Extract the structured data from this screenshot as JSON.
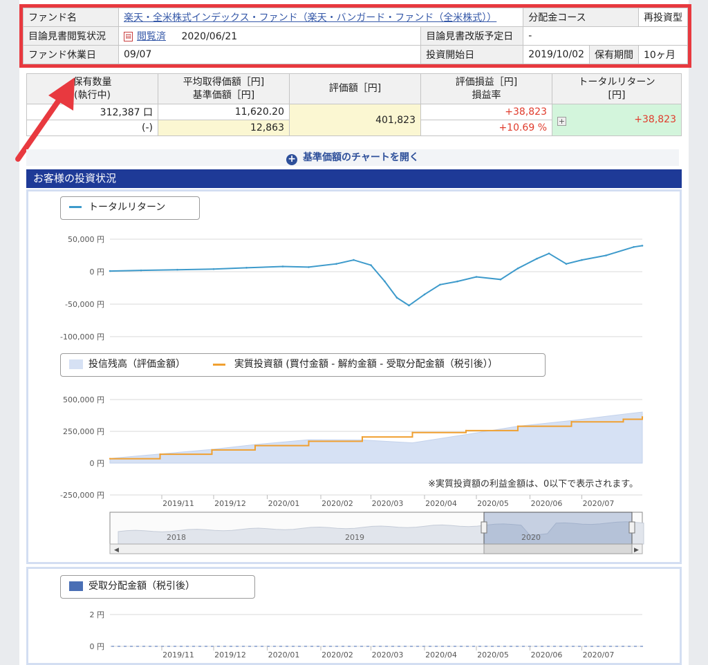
{
  "fund_info": {
    "fund_name_label": "ファンド名",
    "fund_name": "楽天・全米株式インデックス・ファンド（楽天・バンガード・ファンド（全米株式））",
    "dist_course_label": "分配金コース",
    "dist_course": "再投資型",
    "prospectus_status_label": "目論見書閲覧状況",
    "prospectus_link": "閲覧済",
    "prospectus_date": "2020/06/21",
    "prospectus_revision_label": "目論見書改版予定日",
    "prospectus_revision": "-",
    "holiday_label": "ファンド休業日",
    "holiday": "09/07",
    "start_label": "投資開始日",
    "start_date": "2019/10/02",
    "period_label": "保有期間",
    "period": "10ヶ月"
  },
  "holdings": {
    "col_qty": "保有数量",
    "col_qty_sub": "(執行中)",
    "col_avg": "平均取得価額［円]",
    "col_avg_sub": "基準価額［円]",
    "col_value": "評価額［円]",
    "col_pl": "評価損益［円]",
    "col_pl_sub": "損益率",
    "col_total": "トータルリターン",
    "col_total_sub": "[円]",
    "qty": "312,387 口",
    "qty_pending": "(-)",
    "avg_price": "11,620.20",
    "nav": "12,863",
    "value": "401,823",
    "pl": "+38,823",
    "pl_rate": "+10.69 %",
    "total_return": "+38,823"
  },
  "chart_toggle_label": "基準価額のチャートを開く",
  "section_title": "お客様の投資状況",
  "legend_total_return": "トータルリターン",
  "legend_balance": "投信残高（評価金額）",
  "legend_invested": "実質投資額 (買付金額 - 解約金額 - 受取分配金額（税引後））",
  "legend_dist": "受取分配金額（税引後）",
  "note": "※実質投資額の利益金額は、0以下で表示されます。",
  "colors": {
    "accent_red": "#e8393f",
    "header_blue": "#1e3a97",
    "line_blue": "#3d9acb",
    "orange": "#f0a030",
    "area_fill": "#d6e1f4",
    "dist_blue": "#4a6fb5"
  },
  "chart_data": [
    {
      "type": "line",
      "title": "トータルリターン",
      "ylim": [
        -100000,
        50000
      ],
      "y_ticks": [
        "50,000 円",
        "0 円",
        "-50,000 円",
        "-100,000 円"
      ],
      "x_ticks": [
        "2019/11",
        "2019/12",
        "2020/01",
        "2020/02",
        "2020/03",
        "2020/04",
        "2020/05",
        "2020/06",
        "2020/07"
      ],
      "x": [
        "2019/10/02",
        "2019/10/20",
        "2019/11/10",
        "2019/12/01",
        "2019/12/20",
        "2020/01/10",
        "2020/01/25",
        "2020/02/10",
        "2020/02/20",
        "2020/03/01",
        "2020/03/09",
        "2020/03/16",
        "2020/03/23",
        "2020/04/01",
        "2020/04/10",
        "2020/04/20",
        "2020/05/01",
        "2020/05/15",
        "2020/05/25",
        "2020/06/05",
        "2020/06/12",
        "2020/06/22",
        "2020/07/01",
        "2020/07/15",
        "2020/07/31",
        "2020/08/05"
      ],
      "series": [
        {
          "name": "トータルリターン",
          "values": [
            1000,
            2000,
            3000,
            4000,
            6000,
            8000,
            7000,
            12000,
            18000,
            10000,
            -15000,
            -40000,
            -52000,
            -35000,
            -20000,
            -15000,
            -8000,
            -12000,
            5000,
            20000,
            28000,
            12000,
            18000,
            25000,
            38000,
            40000
          ]
        }
      ]
    },
    {
      "type": "area",
      "title": "",
      "ylim": [
        -250000,
        500000
      ],
      "y_ticks": [
        "500,000 円",
        "250,000 円",
        "0 円",
        "-250,000 円"
      ],
      "x_ticks": [
        "2019/11",
        "2019/12",
        "2020/01",
        "2020/02",
        "2020/03",
        "2020/04",
        "2020/05",
        "2020/06",
        "2020/07"
      ],
      "x": [
        "2019/10/02",
        "2019/10/31",
        "2019/11/30",
        "2019/12/25",
        "2020/01/25",
        "2020/02/25",
        "2020/03/25",
        "2020/04/25",
        "2020/05/25",
        "2020/06/25",
        "2020/07/25",
        "2020/08/05"
      ],
      "series": [
        {
          "name": "投信残高（評価金額）",
          "values": [
            37000,
            72000,
            108000,
            146000,
            184000,
            182000,
            160000,
            225000,
            290000,
            335000,
            385000,
            402000
          ]
        },
        {
          "name": "実質投資額 (買付金額 - 解約金額 - 受取分配金額（税引後））",
          "values": [
            35000,
            70000,
            104000,
            138000,
            172000,
            206000,
            240000,
            256000,
            290000,
            325000,
            345000,
            363000
          ]
        }
      ]
    },
    {
      "type": "bar",
      "title": "受取分配金額（税引後）",
      "ylim": [
        0,
        2
      ],
      "y_ticks": [
        "2 円",
        "0 円"
      ],
      "x_ticks": [
        "2019/11",
        "2019/12",
        "2020/01",
        "2020/02",
        "2020/03",
        "2020/04",
        "2020/05",
        "2020/06",
        "2020/07"
      ],
      "series": [
        {
          "name": "受取分配金額（税引後）",
          "values": [
            0
          ]
        }
      ]
    }
  ],
  "navigator": {
    "year_labels": [
      "2018",
      "2019",
      "2020"
    ]
  }
}
